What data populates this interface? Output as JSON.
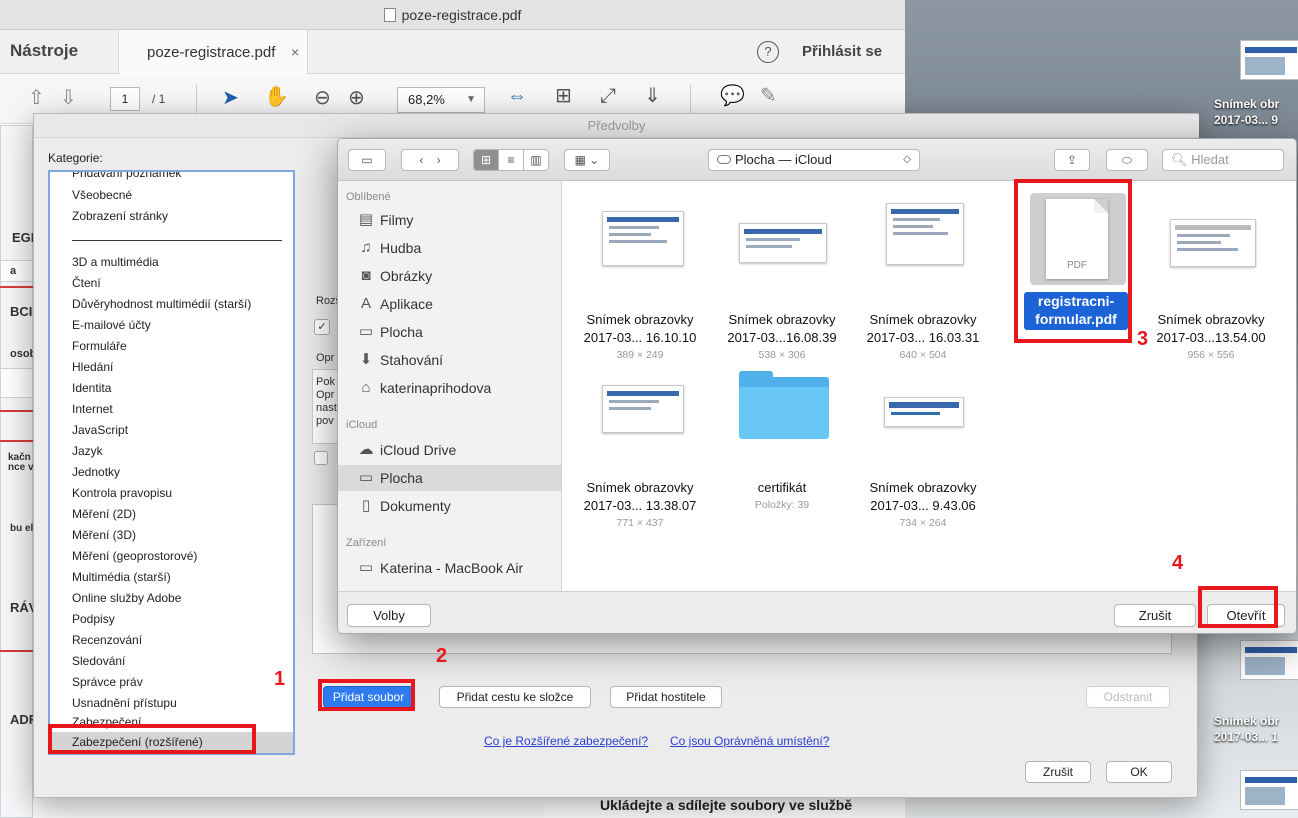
{
  "window": {
    "title": "poze-registrace.pdf"
  },
  "acrobat": {
    "tab_tools": "Nástroje",
    "tab_doc": "poze-registrace.pdf",
    "tab_close": "×",
    "help": "?",
    "signin": "Přihlásit se",
    "page_current": "1",
    "page_total": "/ 1",
    "zoom": "68,2%",
    "doc_labels": [
      "EGI",
      "a",
      "ВCI",
      "osob",
      "kačn",
      "nce v",
      "bu el",
      "RÁVI",
      "ADR"
    ],
    "bottom_text": "Ukládejte a sdílejte soubory ve službě"
  },
  "preferences": {
    "title": "Předvolby",
    "category_label": "Kategorie:",
    "categories_top": [
      "Přidávání poznámek",
      "Všeobecné",
      "Zobrazení stránky"
    ],
    "categories": [
      "3D a multimédia",
      "Čtení",
      "Důvěryhodnost multimédií (starší)",
      "E-mailové účty",
      "Formuláře",
      "Hledání",
      "Identita",
      "Internet",
      "JavaScript",
      "Jazyk",
      "Jednotky",
      "Kontrola pravopisu",
      "Měření (2D)",
      "Měření (3D)",
      "Měření (geoprostorové)",
      "Multimédia (starší)",
      "Online služby Adobe",
      "Podpisy",
      "Recenzování",
      "Sledování",
      "Správce práv",
      "Usnadnění přístupu",
      "Zabezpečení"
    ],
    "selected_category": "Zabezpečení (rozšířené)",
    "panel_fragments": [
      "Rozš",
      "Opr",
      "Pok",
      "Opr",
      "nast",
      "pov"
    ],
    "btn_add_file": "Přidat soubor",
    "btn_add_folder": "Přidat cestu ke složce",
    "btn_add_host": "Přidat hostitele",
    "btn_remove": "Odstranit",
    "link_enhanced": "Co je Rozšířené zabezpečení?",
    "link_privileged": "Co jsou Oprávněná umístění?",
    "btn_cancel": "Zrušit",
    "btn_ok": "OK"
  },
  "file_dialog": {
    "location": "Plocha — iCloud",
    "search_placeholder": "Hledat",
    "sidebar": {
      "favorites_label": "Oblíbené",
      "favorites": [
        "Filmy",
        "Hudba",
        "Obrázky",
        "Aplikace",
        "Plocha",
        "Stahování",
        "katerinaprihodova"
      ],
      "icloud_label": "iCloud",
      "icloud": [
        "iCloud Drive",
        "Plocha",
        "Dokumenty"
      ],
      "devices_label": "Zařízení",
      "devices": [
        "Katerina - MacBook Air"
      ]
    },
    "files": [
      {
        "name1": "Snímek obrazovky",
        "name2": "2017-03... 16.10.10",
        "meta": "389 × 249"
      },
      {
        "name1": "Snímek obrazovky",
        "name2": "2017-03...16.08.39",
        "meta": "538 × 306"
      },
      {
        "name1": "Snímek obrazovky",
        "name2": "2017-03... 16.03.31",
        "meta": "640 × 504"
      },
      {
        "name1": "registracni-",
        "name2": "formular.pdf",
        "meta": "",
        "tag": "PDF"
      },
      {
        "name1": "Snímek obrazovky",
        "name2": "2017-03...13.54.00",
        "meta": "956 × 556"
      },
      {
        "name1": "Snímek obrazovky",
        "name2": "2017-03... 13.38.07",
        "meta": "771 × 437"
      },
      {
        "name1": "certifikát",
        "name2": "Položky: 39",
        "meta": ""
      },
      {
        "name1": "Snímek obrazovky",
        "name2": "2017-03... 9.43.06",
        "meta": "734 × 264"
      }
    ],
    "btn_options": "Volby",
    "btn_cancel": "Zrušit",
    "btn_open": "Otevřít"
  },
  "desktop": {
    "labels": [
      "Snímek obr",
      "2017-03... 9",
      "Snímek obr",
      "2017-03... 1"
    ]
  },
  "annotations": [
    "1",
    "2",
    "3",
    "4"
  ],
  "colors": {
    "annotation": "#e8171c",
    "accent": "#2e7bef",
    "selection": "#1b63d6"
  }
}
